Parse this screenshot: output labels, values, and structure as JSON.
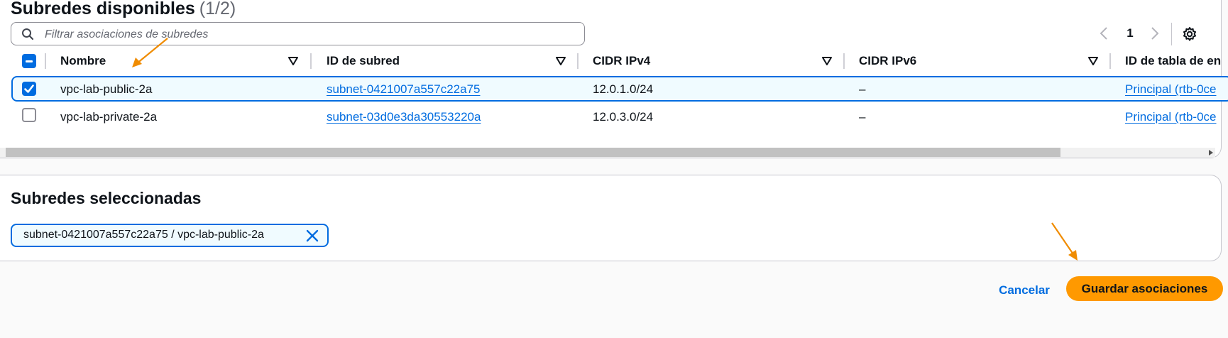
{
  "available": {
    "title": "Subredes disponibles",
    "count": "(1/2)",
    "search_placeholder": "Filtrar asociaciones de subredes",
    "page": "1"
  },
  "table": {
    "columns": [
      "Nombre",
      "ID de subred",
      "CIDR IPv4",
      "CIDR IPv6",
      "ID de tabla de en"
    ],
    "rows": [
      {
        "selected": true,
        "name": "vpc-lab-public-2a",
        "subnet_id": "subnet-0421007a557c22a75",
        "cidr_ipv4": "12.0.1.0/24",
        "cidr_ipv6": "–",
        "route_table": "Principal (rtb-0ce"
      },
      {
        "selected": false,
        "name": "vpc-lab-private-2a",
        "subnet_id": "subnet-03d0e3da30553220a",
        "cidr_ipv4": "12.0.3.0/24",
        "cidr_ipv6": "–",
        "route_table": "Principal (rtb-0ce"
      }
    ]
  },
  "selected_section": {
    "title": "Subredes seleccionadas",
    "token": "subnet-0421007a557c22a75 / vpc-lab-public-2a"
  },
  "footer": {
    "cancel_label": "Cancelar",
    "save_label": "Guardar asociaciones"
  },
  "colors": {
    "accent_blue": "#006ce0",
    "primary_button": "#ff9900",
    "annotation_arrow": "#f08c00",
    "selected_row_bg": "#f0fbff"
  },
  "icons": [
    "search-icon",
    "chevron-left-icon",
    "chevron-right-icon",
    "gear-icon",
    "sort-down-icon",
    "check-icon",
    "close-icon",
    "arrow-annotation-icon"
  ]
}
